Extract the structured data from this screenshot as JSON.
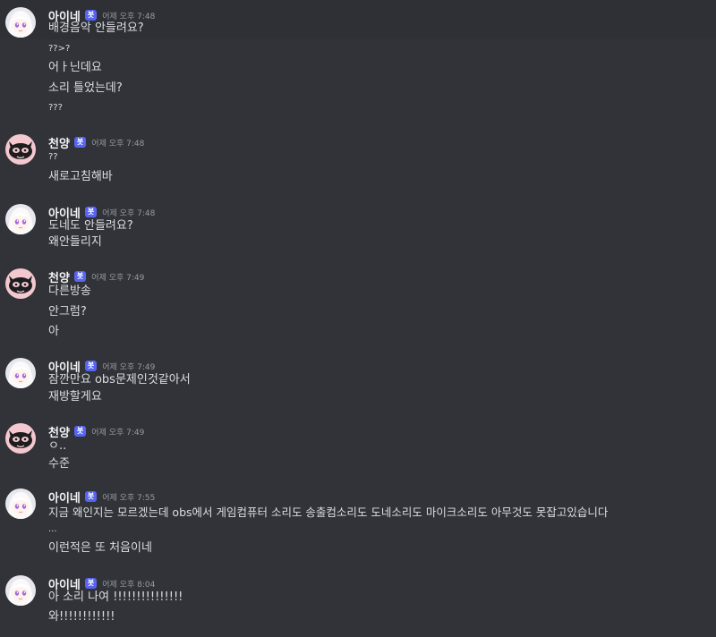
{
  "users": {
    "ine": {
      "name": "아이네",
      "badge": "봇",
      "avatar_icon": "white-hair-anime-girl-avatar"
    },
    "cheonyang": {
      "name": "천양",
      "badge": "봇",
      "avatar_icon": "pink-masked-cat-avatar"
    }
  },
  "messages": [
    {
      "author": "아이네",
      "badge": "봇",
      "timestamp": "어제 오후 7:48",
      "lines": [
        "배경음악 안들려요?",
        "??>?",
        "어ㅏ닌데요",
        "소리 틀었는데?",
        "???"
      ]
    },
    {
      "author": "천양",
      "badge": "봇",
      "timestamp": "어제 오후 7:48",
      "lines": [
        "??",
        "새로고침해바"
      ]
    },
    {
      "author": "아이네",
      "badge": "봇",
      "timestamp": "어제 오후 7:48",
      "lines": [
        "도네도 안들려요?",
        "왜안들리지"
      ]
    },
    {
      "author": "천양",
      "badge": "봇",
      "timestamp": "어제 오후 7:49",
      "lines": [
        "다른방송",
        "안그럼?",
        "아"
      ]
    },
    {
      "author": "아이네",
      "badge": "봇",
      "timestamp": "어제 오후 7:49",
      "lines": [
        "잠깐만요 obs문제인것같아서",
        "재방할게요"
      ]
    },
    {
      "author": "천양",
      "badge": "봇",
      "timestamp": "어제 오후 7:49",
      "lines": [
        "ㅇ..",
        "수준"
      ]
    },
    {
      "author": "아이네",
      "badge": "봇",
      "timestamp": "어제 오후 7:55",
      "lines": [
        "지금 왜인지는 모르겠는데 obs에서 게임컴퓨터 소리도 송출컴소리도 도네소리도 마이크소리도 아무것도 못잡고있습니다",
        "...",
        "이런적은 또 처음이네"
      ]
    },
    {
      "author": "아이네",
      "badge": "봇",
      "timestamp": "어제 오후 8:04",
      "lines": [
        "아 소리 나여 !!!!!!!!!!!!!!!",
        "와!!!!!!!!!!!!"
      ]
    }
  ]
}
